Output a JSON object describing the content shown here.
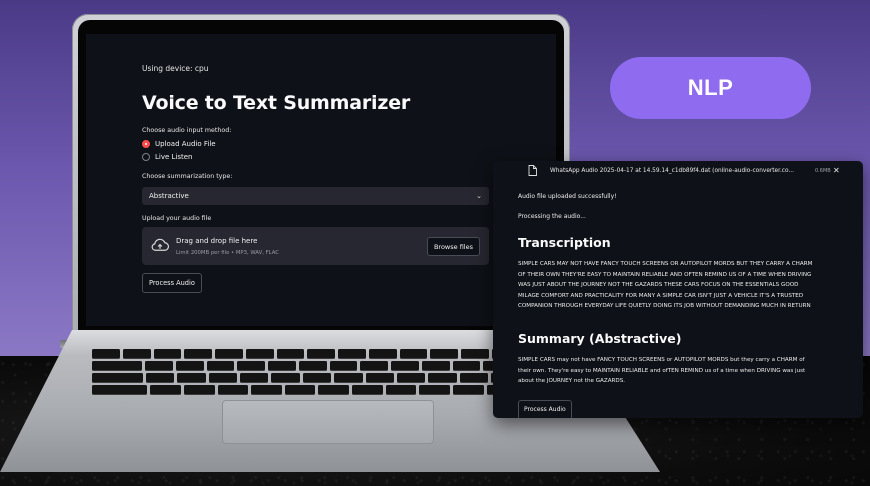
{
  "badge": {
    "label": "NLP",
    "color": "#8f6bf0"
  },
  "app": {
    "device_text": "Using device: cpu",
    "title": "Voice to Text Summarizer",
    "input_method_label": "Choose audio input method:",
    "input_options": [
      {
        "label": "Upload Audio File",
        "selected": true
      },
      {
        "label": "Live Listen",
        "selected": false
      }
    ],
    "summarization_label": "Choose summarization type:",
    "summarization_value": "Abstractive",
    "upload_label": "Upload your audio file",
    "dropzone_title": "Drag and drop file here",
    "dropzone_sub": "Limit 200MB per file • MP3, WAV, FLAC",
    "browse_label": "Browse files",
    "process_label": "Process Audio",
    "accent_color": "#ff4b4b"
  },
  "panel": {
    "file_name": "WhatsApp Audio 2025-04-17 at 14.59.14_c1db89f4.dat (online-audio-converter.co...",
    "file_size": "0.6MB",
    "status_uploaded": "Audio file uploaded successfully!",
    "status_processing": "Processing the audio...",
    "transcription_heading": "Transcription",
    "transcription_lines": [
      "SIMPLE CARS MAY NOT HAVE FANCY TOUCH SCREENS OR AUTOPILOT MORDS BUT THEY CARRY A CHARM",
      "OF THEIR OWN THEY'RE EASY TO MAINTAIN RELIABLE AND OFTEN REMIND US OF A TIME WHEN DRIVING",
      "WAS JUST ABOUT THE JOURNEY NOT THE GAZARDS THESE CARS FOCUS ON THE ESSENTIALS GOOD",
      "MILAGE COMFORT AND PRACTICALITY FOR MANY A SIMPLE CAR ISN'T JUST A VEHICLE IT'S A TRUSTED",
      "COMPANION THROUGH EVERYDAY LIFE QUIETLY DOING ITS JOB WITHOUT DEMANDING MUCH IN RETURN"
    ],
    "summary_heading": "Summary (Abstractive)",
    "summary_lines": [
      "SIMPLE CARS may not have FANCY TOUCH SCREENS or AUTOPILOT MORDS but they carry a CHARM of",
      "their own. They're easy to MAINTAIN RELIABLE and ofTEN REMIND us of a time when DRIVING was just",
      "about the JOURNEY not the GAZARDS."
    ],
    "process_label": "Process Audio"
  }
}
